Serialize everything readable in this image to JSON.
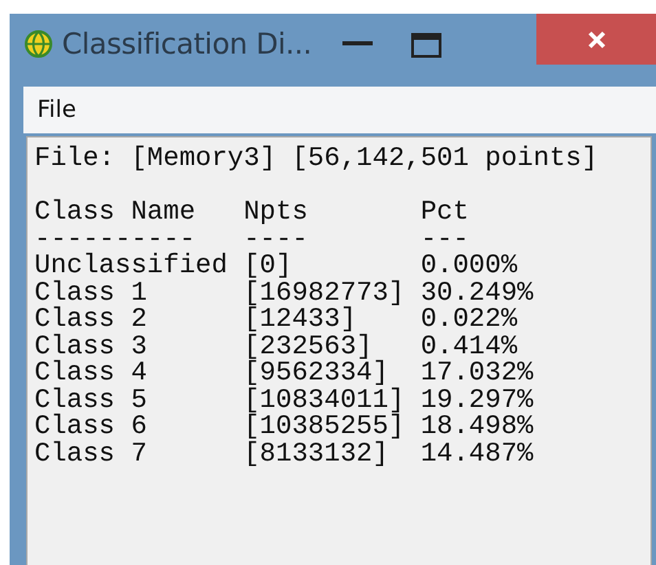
{
  "window": {
    "title": "Classification Di..."
  },
  "menu": [
    "File"
  ],
  "file_line": "File: [Memory3] [56,142,501 points]",
  "columns": [
    {
      "label": "Class Name",
      "rule": "----------"
    },
    {
      "label": "Npts",
      "rule": "----"
    },
    {
      "label": "Pct",
      "rule": "---"
    }
  ],
  "rows": [
    [
      "Unclassified",
      "[0]",
      "0.000%"
    ],
    [
      "Class 1",
      "[16982773]",
      "30.249%"
    ],
    [
      "Class 2",
      "[12433]",
      "0.022%"
    ],
    [
      "Class 3",
      "[232563]",
      "0.414%"
    ],
    [
      "Class 4",
      "[9562334]",
      "17.032%"
    ],
    [
      "Class 5",
      "[10834011]",
      "19.297%"
    ],
    [
      "Class 6",
      "[10385255]",
      "18.498%"
    ],
    [
      "Class 7",
      "[8133132]",
      "14.487%"
    ]
  ]
}
